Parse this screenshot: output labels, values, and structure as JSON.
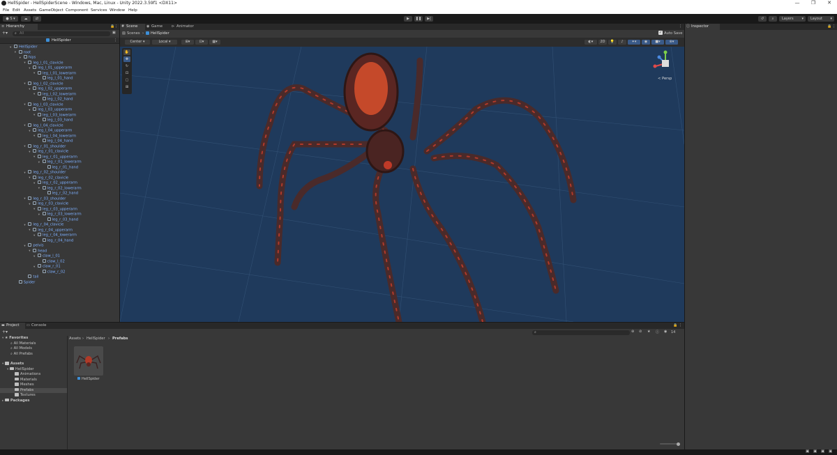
{
  "window": {
    "title": "HellSpider - HellSpiderScene - Windows, Mac, Linux - Unity 2022.3.59f1 <DX11>"
  },
  "menu": [
    "File",
    "Edit",
    "Assets",
    "GameObject",
    "Component",
    "Services",
    "Window",
    "Help"
  ],
  "toolbar": {
    "account_label": "S",
    "layers_label": "Layers",
    "layout_label": "Layout"
  },
  "hierarchy": {
    "tab_label": "Hierarchy",
    "search_placeholder": "All",
    "scene_name": "HellSpider",
    "items": [
      {
        "label": "HellSpider",
        "depth": 0,
        "fold": "v"
      },
      {
        "label": "root",
        "depth": 1,
        "fold": "v"
      },
      {
        "label": "hips",
        "depth": 2,
        "fold": "v"
      },
      {
        "label": "leg_l_01_clavicle",
        "depth": 3,
        "fold": "v"
      },
      {
        "label": "leg_l_01_upperarm",
        "depth": 4,
        "fold": "v"
      },
      {
        "label": "leg_l_01_lowerarm",
        "depth": 5,
        "fold": "v"
      },
      {
        "label": "leg_l_01_hand",
        "depth": 6,
        "fold": ""
      },
      {
        "label": "leg_l_02_clavicle",
        "depth": 3,
        "fold": "v"
      },
      {
        "label": "leg_l_02_upperarm",
        "depth": 4,
        "fold": "v"
      },
      {
        "label": "leg_l_02_lowerarm",
        "depth": 5,
        "fold": "v"
      },
      {
        "label": "leg_l_02_hand",
        "depth": 6,
        "fold": ""
      },
      {
        "label": "leg_l_03_clavicle",
        "depth": 3,
        "fold": "v"
      },
      {
        "label": "leg_l_03_upperarm",
        "depth": 4,
        "fold": "v"
      },
      {
        "label": "leg_l_03_lowerarm",
        "depth": 5,
        "fold": "v"
      },
      {
        "label": "leg_l_03_hand",
        "depth": 6,
        "fold": ""
      },
      {
        "label": "leg_l_04_clavicle",
        "depth": 3,
        "fold": "v"
      },
      {
        "label": "leg_l_04_upperarm",
        "depth": 4,
        "fold": "v"
      },
      {
        "label": "leg_l_04_lowerarm",
        "depth": 5,
        "fold": "v"
      },
      {
        "label": "leg_l_04_hand",
        "depth": 6,
        "fold": ""
      },
      {
        "label": "leg_r_01_shoulder",
        "depth": 3,
        "fold": "v"
      },
      {
        "label": "leg_r_01_clavicle",
        "depth": 4,
        "fold": "v"
      },
      {
        "label": "leg_r_01_upperarm",
        "depth": 5,
        "fold": "v"
      },
      {
        "label": "leg_r_01_lowerarm",
        "depth": 6,
        "fold": "v"
      },
      {
        "label": "leg_r_01_hand",
        "depth": 7,
        "fold": ""
      },
      {
        "label": "leg_r_02_shoulder",
        "depth": 3,
        "fold": "v"
      },
      {
        "label": "leg_r_02_clavicle",
        "depth": 4,
        "fold": "v"
      },
      {
        "label": "leg_r_02_upperarm",
        "depth": 5,
        "fold": "v"
      },
      {
        "label": "leg_r_02_lowerarm",
        "depth": 6,
        "fold": "v"
      },
      {
        "label": "leg_r_02_hand",
        "depth": 7,
        "fold": ""
      },
      {
        "label": "leg_r_03_shoulder",
        "depth": 3,
        "fold": "v"
      },
      {
        "label": "leg_r_03_clavicle",
        "depth": 4,
        "fold": "v"
      },
      {
        "label": "leg_r_03_upperarm",
        "depth": 5,
        "fold": "v"
      },
      {
        "label": "leg_r_03_lowerarm",
        "depth": 6,
        "fold": "v"
      },
      {
        "label": "leg_r_03_hand",
        "depth": 7,
        "fold": ""
      },
      {
        "label": "leg_r_04_clavicle",
        "depth": 3,
        "fold": "v"
      },
      {
        "label": "leg_r_04_upperarm",
        "depth": 4,
        "fold": "v"
      },
      {
        "label": "leg_r_04_lowerarm",
        "depth": 5,
        "fold": "v"
      },
      {
        "label": "leg_r_04_hand",
        "depth": 6,
        "fold": ""
      },
      {
        "label": "pelvis",
        "depth": 3,
        "fold": "v"
      },
      {
        "label": "head",
        "depth": 4,
        "fold": "v"
      },
      {
        "label": "claw_l_01",
        "depth": 5,
        "fold": "v"
      },
      {
        "label": "claw_l_02",
        "depth": 6,
        "fold": ""
      },
      {
        "label": "claw_r_01",
        "depth": 5,
        "fold": "v"
      },
      {
        "label": "claw_r_02",
        "depth": 6,
        "fold": ""
      },
      {
        "label": "tail",
        "depth": 3,
        "fold": ""
      },
      {
        "label": "Spider",
        "depth": 1,
        "fold": ""
      }
    ]
  },
  "scene_tabs": [
    {
      "label": "Scene",
      "active": true,
      "icon": "grid-icon"
    },
    {
      "label": "Game",
      "active": false,
      "icon": "gamepad-icon"
    },
    {
      "label": "Animator",
      "active": false,
      "icon": "animator-icon"
    }
  ],
  "scene": {
    "breadcrumb_root": "Scenes",
    "breadcrumb_current": "HellSpider",
    "auto_save_label": "Auto Save",
    "pivot_label": "Center",
    "space_label": "Local",
    "persp_label": "< Persp",
    "bg_color": "#1f3a5c"
  },
  "inspector": {
    "tab_label": "Inspector"
  },
  "project": {
    "tabs": [
      "Project",
      "Console"
    ],
    "favorites_label": "Favorites",
    "favorites": [
      "All Materials",
      "All Models",
      "All Prefabs"
    ],
    "assets_label": "Assets",
    "assets_tree": [
      {
        "label": "HellSpider",
        "depth": 1
      },
      {
        "label": "Animations",
        "depth": 2
      },
      {
        "label": "Materials",
        "depth": 2
      },
      {
        "label": "Meshes",
        "depth": 2
      },
      {
        "label": "Prefabs",
        "depth": 2
      },
      {
        "label": "Textures",
        "depth": 2
      }
    ],
    "packages_label": "Packages",
    "breadcrumb": [
      "Assets",
      "HellSpider",
      "Prefabs"
    ],
    "asset_item_label": "HellSpider",
    "hidden_count": "14"
  }
}
